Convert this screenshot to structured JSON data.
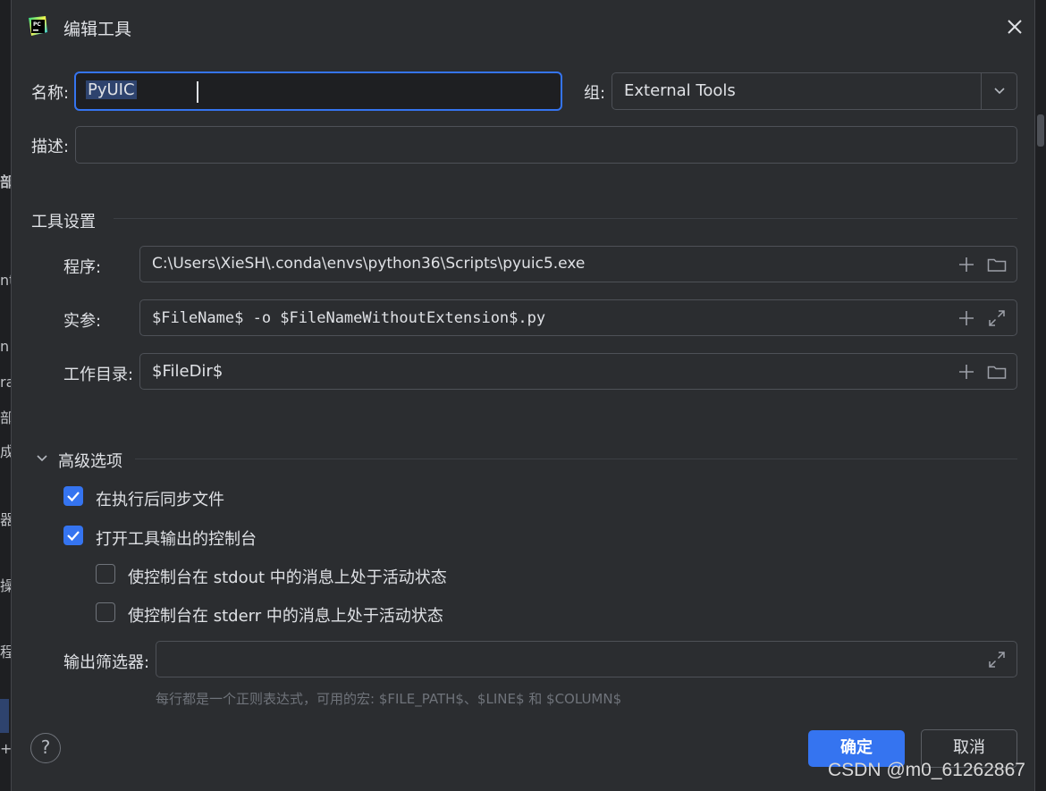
{
  "dialog": {
    "title": "编辑工具",
    "app_icon": "pycharm-logo-icon",
    "close_icon": "close-icon"
  },
  "name": {
    "label": "名称:",
    "value": "PyUIC"
  },
  "group": {
    "label": "组:",
    "value": "External Tools",
    "dropdown_icon": "chevron-down-icon"
  },
  "description": {
    "label": "描述:",
    "value": ""
  },
  "tool_settings": {
    "heading": "工具设置",
    "program": {
      "label": "程序:",
      "value": "C:\\Users\\XieSH\\.conda\\envs\\python36\\Scripts\\pyuic5.exe",
      "icons": [
        "plus-icon",
        "folder-icon"
      ]
    },
    "arguments": {
      "label": "实参:",
      "value": "$FileName$ -o $FileNameWithoutExtension$.py",
      "icons": [
        "plus-icon",
        "expand-icon"
      ]
    },
    "working_dir": {
      "label": "工作目录:",
      "value": "$FileDir$",
      "icons": [
        "plus-icon",
        "folder-icon"
      ]
    }
  },
  "advanced": {
    "heading": "高级选项",
    "expanded": true,
    "sync_files": {
      "label": "在执行后同步文件",
      "checked": true
    },
    "open_console": {
      "label": "打开工具输出的控制台",
      "checked": true
    },
    "activate_stdout": {
      "label": "使控制台在 stdout 中的消息上处于活动状态",
      "checked": false
    },
    "activate_stderr": {
      "label": "使控制台在 stderr 中的消息上处于活动状态",
      "checked": false
    },
    "output_filters": {
      "label": "输出筛选器:",
      "value": "",
      "icon": "expand-icon"
    },
    "hint": "每行都是一个正则表达式，可用的宏: $FILE_PATH$、$LINE$ 和 $COLUMN$"
  },
  "buttons": {
    "help_icon": "help-icon",
    "ok": "确定",
    "cancel": "取消"
  },
  "watermark": "CSDN @m0_61262867",
  "background_fragments": [
    "部",
    "nt",
    "n",
    "ra",
    "部",
    "成",
    "器",
    "操作",
    "程序",
    "+"
  ],
  "colors": {
    "accent": "#3574f0",
    "background": "#2b2d30",
    "field": "#1e1f22",
    "text": "#dfe1e5",
    "hint": "#6f737a"
  }
}
